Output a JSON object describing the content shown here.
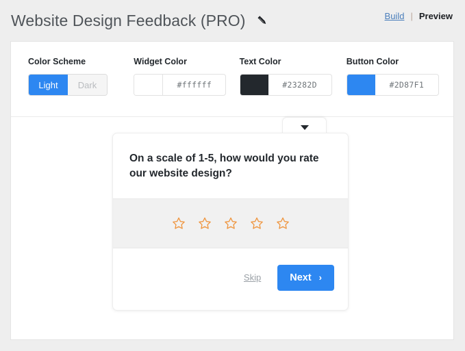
{
  "header": {
    "title": "Website Design Feedback (PRO)",
    "edit_icon": "pencil-icon",
    "build_label": "Build",
    "separator": "|",
    "preview_label": "Preview"
  },
  "settings": {
    "color_scheme": {
      "label": "Color Scheme",
      "options": [
        {
          "label": "Light",
          "selected": true
        },
        {
          "label": "Dark",
          "selected": false
        }
      ]
    },
    "widget_color": {
      "label": "Widget Color",
      "value": "#ffffff",
      "swatch": "#ffffff"
    },
    "text_color": {
      "label": "Text Color",
      "value": "#23282D",
      "swatch": "#23282D"
    },
    "button_color": {
      "label": "Button Color",
      "value": "#2D87F1",
      "swatch": "#2D87F1"
    }
  },
  "preview": {
    "collapse_icon": "caret-down-icon",
    "question": "On a scale of 1-5, how would you rate our website design?",
    "stars": {
      "count": 5,
      "filled": 0,
      "color": "#ef9640",
      "icon": "star-outline-icon"
    },
    "skip_label": "Skip",
    "next_label": "Next",
    "next_chevron": "›"
  },
  "colors": {
    "page_bg": "#eeeeee",
    "card_bg": "#ffffff",
    "accent_blue": "#2d87f1",
    "link_blue": "#4a7ebb",
    "text_dark": "#23282d",
    "star_orange": "#ef9640",
    "stars_band_bg": "#f1f1f1"
  }
}
